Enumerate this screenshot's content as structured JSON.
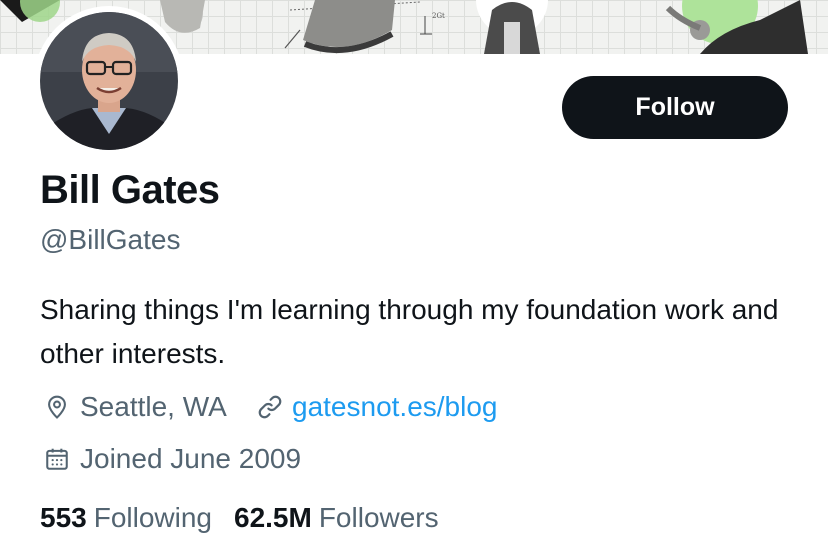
{
  "banner": {
    "annotation": "2Gt"
  },
  "profile": {
    "display_name": "Bill Gates",
    "handle": "@BillGates",
    "bio": "Sharing things I'm learning through my foundation work and other interests.",
    "location": "Seattle, WA",
    "website": "gatesnot.es/blog",
    "joined": "Joined June 2009"
  },
  "actions": {
    "follow_label": "Follow"
  },
  "stats": {
    "following_count": "553",
    "following_label": "Following",
    "followers_count": "62.5M",
    "followers_label": "Followers"
  },
  "icons": {
    "location": "map-pin-icon",
    "website": "link-icon",
    "joined": "calendar-icon"
  },
  "colors": {
    "text_primary": "#0f1419",
    "text_secondary": "#536471",
    "link": "#1d9bf0",
    "button_bg": "#0f1419",
    "button_text": "#ffffff"
  }
}
